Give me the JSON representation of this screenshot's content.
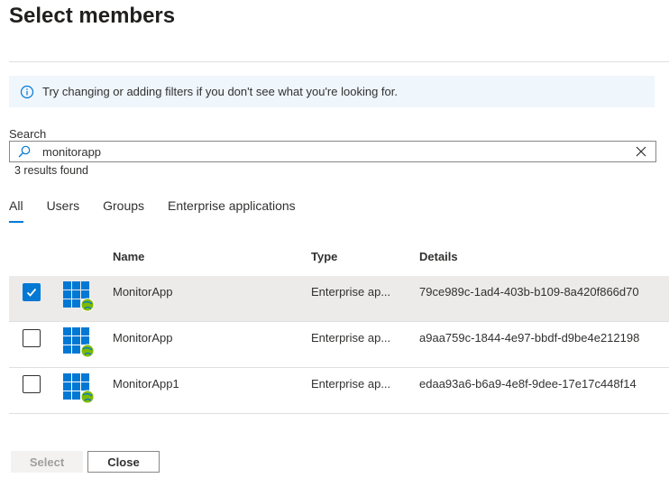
{
  "header": {
    "title": "Select members"
  },
  "info": {
    "message": "Try changing or adding filters if you don't see what you're looking for.",
    "icon": "info-icon"
  },
  "search": {
    "label": "Search",
    "value": "monitorapp",
    "results_text": "3 results found"
  },
  "tabs": [
    {
      "label": "All",
      "active": true
    },
    {
      "label": "Users",
      "active": false
    },
    {
      "label": "Groups",
      "active": false
    },
    {
      "label": "Enterprise applications",
      "active": false
    }
  ],
  "table": {
    "columns": {
      "name": "Name",
      "type": "Type",
      "details": "Details"
    },
    "rows": [
      {
        "name": "MonitorApp",
        "type": "Enterprise ap...",
        "details": "79ce989c-1ad4-403b-b109-8a420f866d70",
        "checked": true
      },
      {
        "name": "MonitorApp",
        "type": "Enterprise ap...",
        "details": "a9aa759c-1844-4e97-bbdf-d9be4e212198",
        "checked": false
      },
      {
        "name": "MonitorApp1",
        "type": "Enterprise ap...",
        "details": "edaa93a6-b6a9-4e8f-9dee-17e17c448f14",
        "checked": false
      }
    ]
  },
  "footer": {
    "select_label": "Select",
    "close_label": "Close"
  },
  "colors": {
    "accent": "#0078d4",
    "info_bg": "#eff6fc",
    "selected_row": "#edebe9"
  }
}
